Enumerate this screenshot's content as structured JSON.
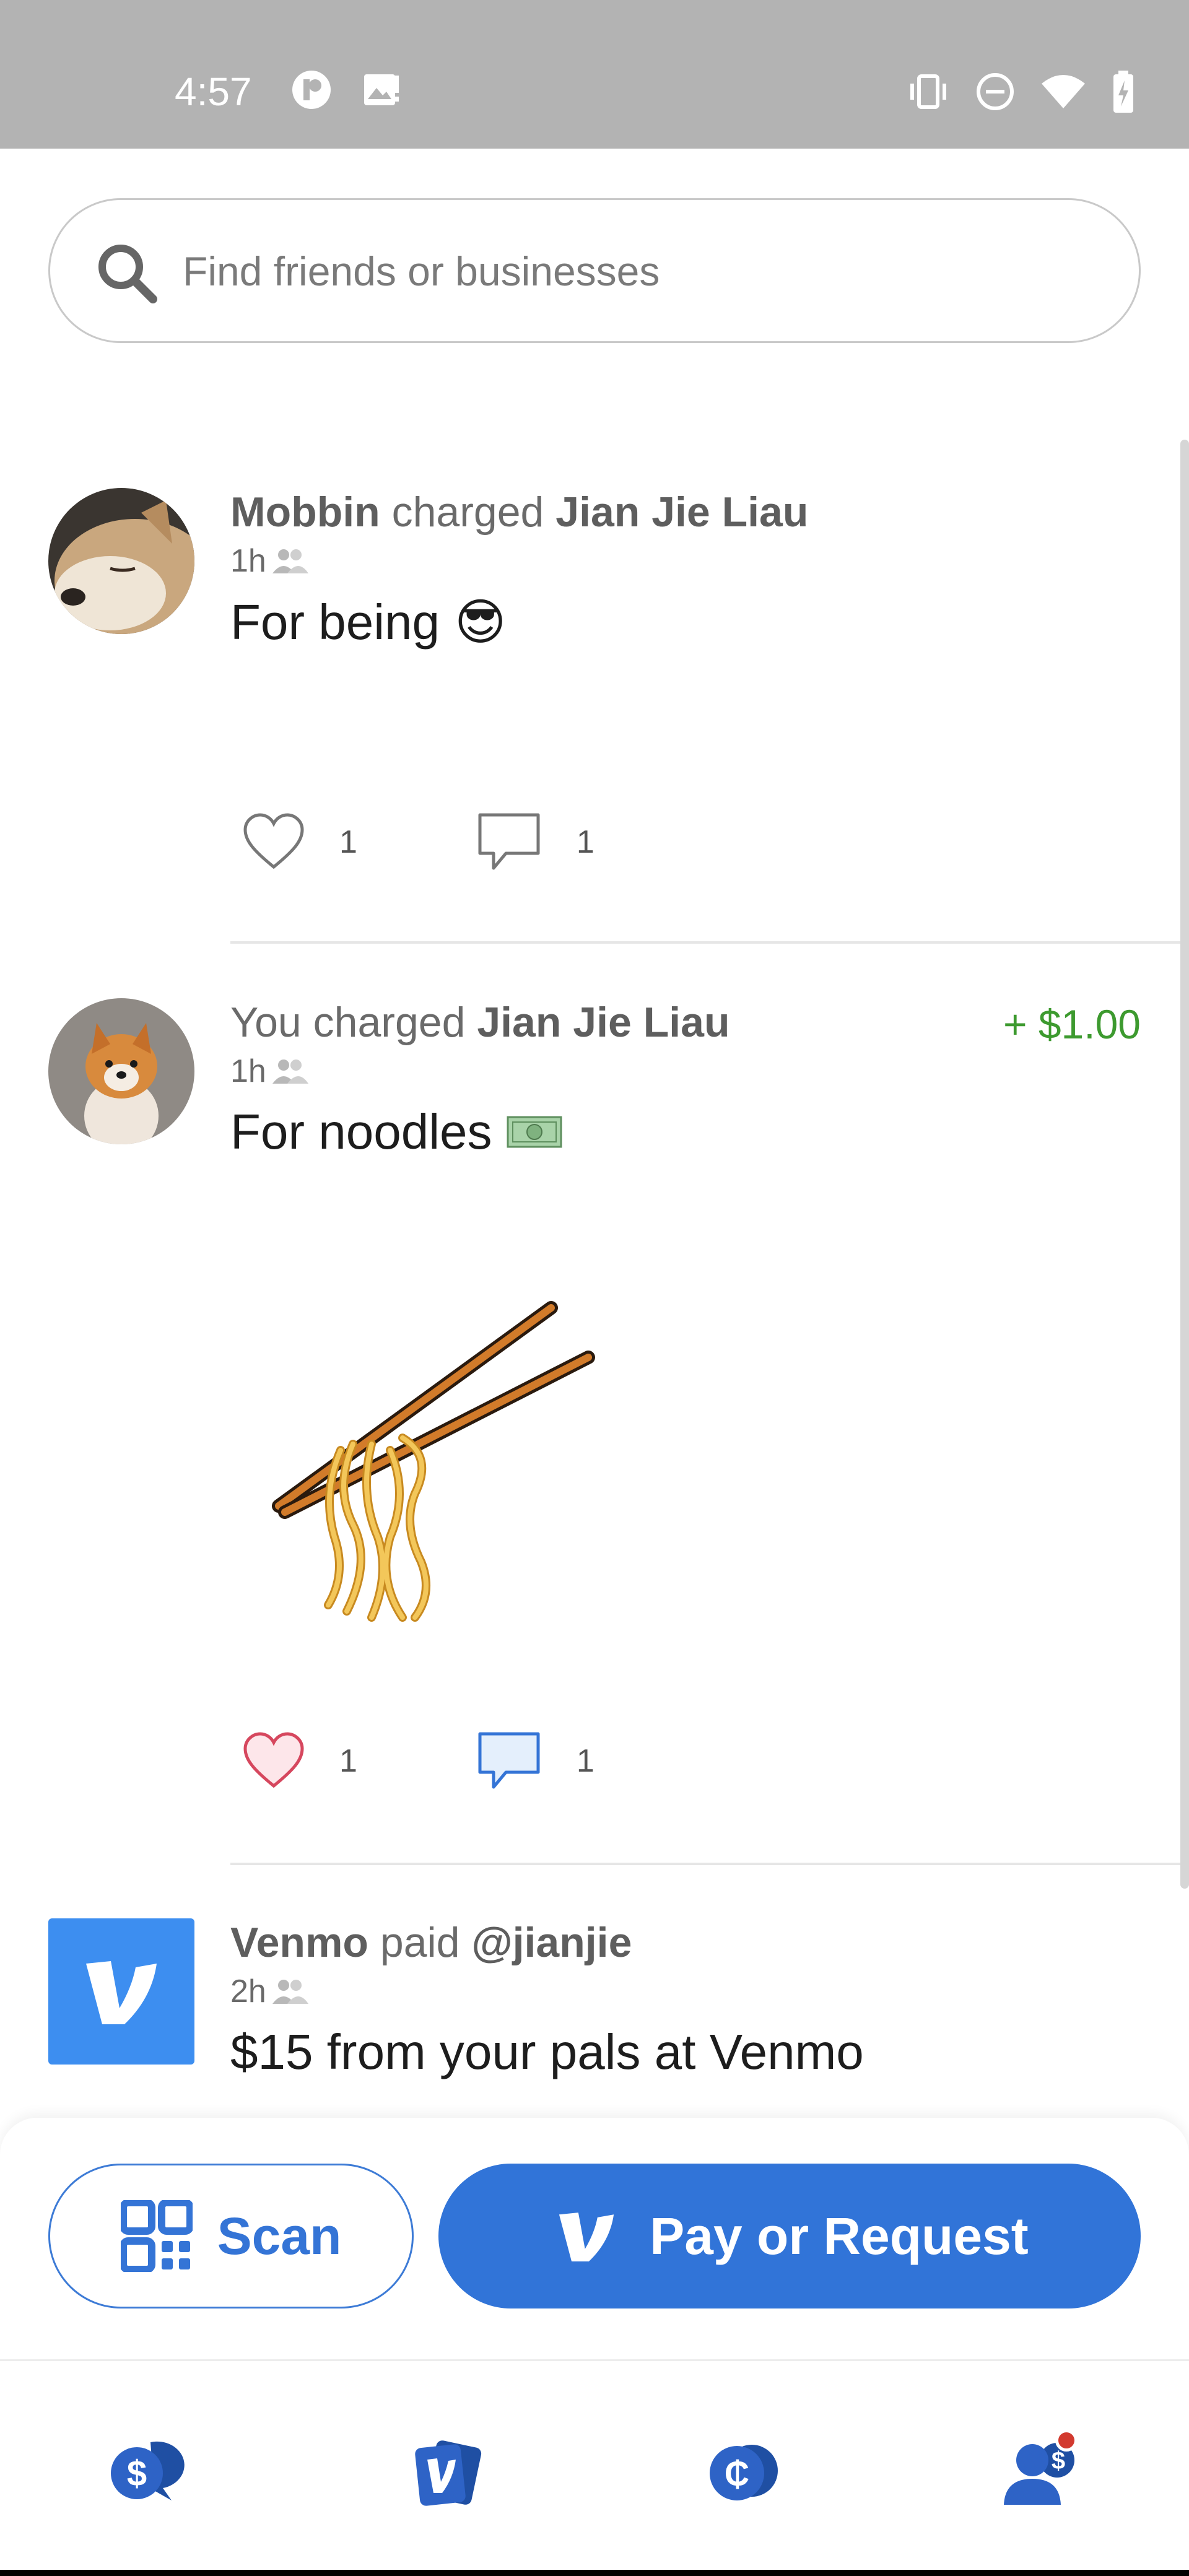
{
  "status_bar": {
    "time": "4:57"
  },
  "search": {
    "placeholder": "Find friends or businesses"
  },
  "feed": [
    {
      "actor": "Mobbin",
      "verb": "charged",
      "target": "Jian Jie Liau",
      "time": "1h",
      "note": "For being",
      "note_emoji": "😎",
      "likes": "1",
      "comments": "1",
      "liked": false
    },
    {
      "actor": "You",
      "verb": "charged",
      "target": "Jian Jie Liau",
      "amount": "+ $1.00",
      "time": "1h",
      "note": "For noodles",
      "note_emoji": "💵",
      "likes": "1",
      "comments": "1",
      "liked": true
    },
    {
      "actor": "Venmo",
      "verb": "paid",
      "target": "@jianjie",
      "time": "2h",
      "note": "$15 from your pals at Venmo"
    }
  ],
  "actions": {
    "scan_label": "Scan",
    "pay_label": "Pay or Request"
  },
  "nav": {
    "items": [
      "home",
      "cards",
      "crypto",
      "me"
    ],
    "badge_on": "me"
  },
  "colors": {
    "brand_blue": "#3174d8",
    "amount_green": "#3d9a2f",
    "badge_red": "#d23a2f"
  }
}
